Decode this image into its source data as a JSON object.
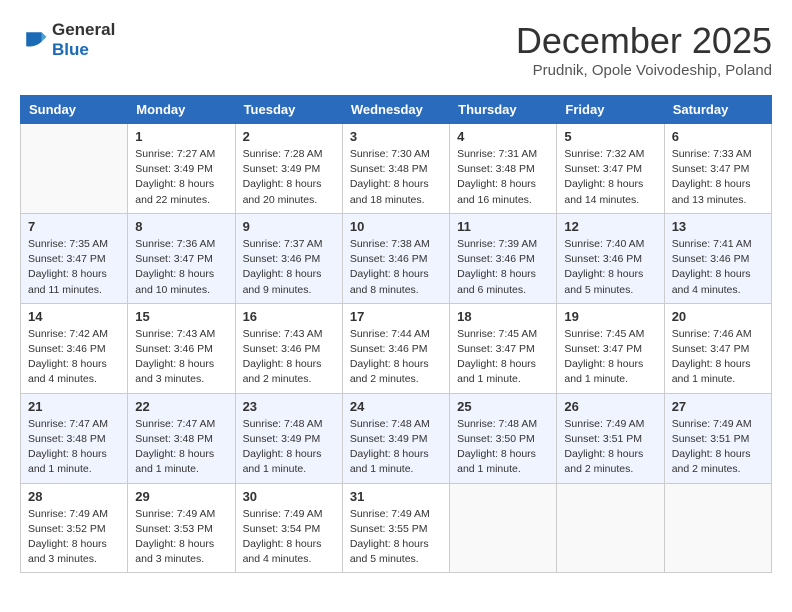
{
  "header": {
    "logo": {
      "general": "General",
      "blue": "Blue"
    },
    "title": "December 2025",
    "location": "Prudnik, Opole Voivodeship, Poland"
  },
  "calendar": {
    "days_of_week": [
      "Sunday",
      "Monday",
      "Tuesday",
      "Wednesday",
      "Thursday",
      "Friday",
      "Saturday"
    ],
    "weeks": [
      [
        {
          "day": "",
          "info": ""
        },
        {
          "day": "1",
          "info": "Sunrise: 7:27 AM\nSunset: 3:49 PM\nDaylight: 8 hours\nand 22 minutes."
        },
        {
          "day": "2",
          "info": "Sunrise: 7:28 AM\nSunset: 3:49 PM\nDaylight: 8 hours\nand 20 minutes."
        },
        {
          "day": "3",
          "info": "Sunrise: 7:30 AM\nSunset: 3:48 PM\nDaylight: 8 hours\nand 18 minutes."
        },
        {
          "day": "4",
          "info": "Sunrise: 7:31 AM\nSunset: 3:48 PM\nDaylight: 8 hours\nand 16 minutes."
        },
        {
          "day": "5",
          "info": "Sunrise: 7:32 AM\nSunset: 3:47 PM\nDaylight: 8 hours\nand 14 minutes."
        },
        {
          "day": "6",
          "info": "Sunrise: 7:33 AM\nSunset: 3:47 PM\nDaylight: 8 hours\nand 13 minutes."
        }
      ],
      [
        {
          "day": "7",
          "info": "Sunrise: 7:35 AM\nSunset: 3:47 PM\nDaylight: 8 hours\nand 11 minutes."
        },
        {
          "day": "8",
          "info": "Sunrise: 7:36 AM\nSunset: 3:47 PM\nDaylight: 8 hours\nand 10 minutes."
        },
        {
          "day": "9",
          "info": "Sunrise: 7:37 AM\nSunset: 3:46 PM\nDaylight: 8 hours\nand 9 minutes."
        },
        {
          "day": "10",
          "info": "Sunrise: 7:38 AM\nSunset: 3:46 PM\nDaylight: 8 hours\nand 8 minutes."
        },
        {
          "day": "11",
          "info": "Sunrise: 7:39 AM\nSunset: 3:46 PM\nDaylight: 8 hours\nand 6 minutes."
        },
        {
          "day": "12",
          "info": "Sunrise: 7:40 AM\nSunset: 3:46 PM\nDaylight: 8 hours\nand 5 minutes."
        },
        {
          "day": "13",
          "info": "Sunrise: 7:41 AM\nSunset: 3:46 PM\nDaylight: 8 hours\nand 4 minutes."
        }
      ],
      [
        {
          "day": "14",
          "info": "Sunrise: 7:42 AM\nSunset: 3:46 PM\nDaylight: 8 hours\nand 4 minutes."
        },
        {
          "day": "15",
          "info": "Sunrise: 7:43 AM\nSunset: 3:46 PM\nDaylight: 8 hours\nand 3 minutes."
        },
        {
          "day": "16",
          "info": "Sunrise: 7:43 AM\nSunset: 3:46 PM\nDaylight: 8 hours\nand 2 minutes."
        },
        {
          "day": "17",
          "info": "Sunrise: 7:44 AM\nSunset: 3:46 PM\nDaylight: 8 hours\nand 2 minutes."
        },
        {
          "day": "18",
          "info": "Sunrise: 7:45 AM\nSunset: 3:47 PM\nDaylight: 8 hours\nand 1 minute."
        },
        {
          "day": "19",
          "info": "Sunrise: 7:45 AM\nSunset: 3:47 PM\nDaylight: 8 hours\nand 1 minute."
        },
        {
          "day": "20",
          "info": "Sunrise: 7:46 AM\nSunset: 3:47 PM\nDaylight: 8 hours\nand 1 minute."
        }
      ],
      [
        {
          "day": "21",
          "info": "Sunrise: 7:47 AM\nSunset: 3:48 PM\nDaylight: 8 hours\nand 1 minute."
        },
        {
          "day": "22",
          "info": "Sunrise: 7:47 AM\nSunset: 3:48 PM\nDaylight: 8 hours\nand 1 minute."
        },
        {
          "day": "23",
          "info": "Sunrise: 7:48 AM\nSunset: 3:49 PM\nDaylight: 8 hours\nand 1 minute."
        },
        {
          "day": "24",
          "info": "Sunrise: 7:48 AM\nSunset: 3:49 PM\nDaylight: 8 hours\nand 1 minute."
        },
        {
          "day": "25",
          "info": "Sunrise: 7:48 AM\nSunset: 3:50 PM\nDaylight: 8 hours\nand 1 minute."
        },
        {
          "day": "26",
          "info": "Sunrise: 7:49 AM\nSunset: 3:51 PM\nDaylight: 8 hours\nand 2 minutes."
        },
        {
          "day": "27",
          "info": "Sunrise: 7:49 AM\nSunset: 3:51 PM\nDaylight: 8 hours\nand 2 minutes."
        }
      ],
      [
        {
          "day": "28",
          "info": "Sunrise: 7:49 AM\nSunset: 3:52 PM\nDaylight: 8 hours\nand 3 minutes."
        },
        {
          "day": "29",
          "info": "Sunrise: 7:49 AM\nSunset: 3:53 PM\nDaylight: 8 hours\nand 3 minutes."
        },
        {
          "day": "30",
          "info": "Sunrise: 7:49 AM\nSunset: 3:54 PM\nDaylight: 8 hours\nand 4 minutes."
        },
        {
          "day": "31",
          "info": "Sunrise: 7:49 AM\nSunset: 3:55 PM\nDaylight: 8 hours\nand 5 minutes."
        },
        {
          "day": "",
          "info": ""
        },
        {
          "day": "",
          "info": ""
        },
        {
          "day": "",
          "info": ""
        }
      ]
    ]
  }
}
